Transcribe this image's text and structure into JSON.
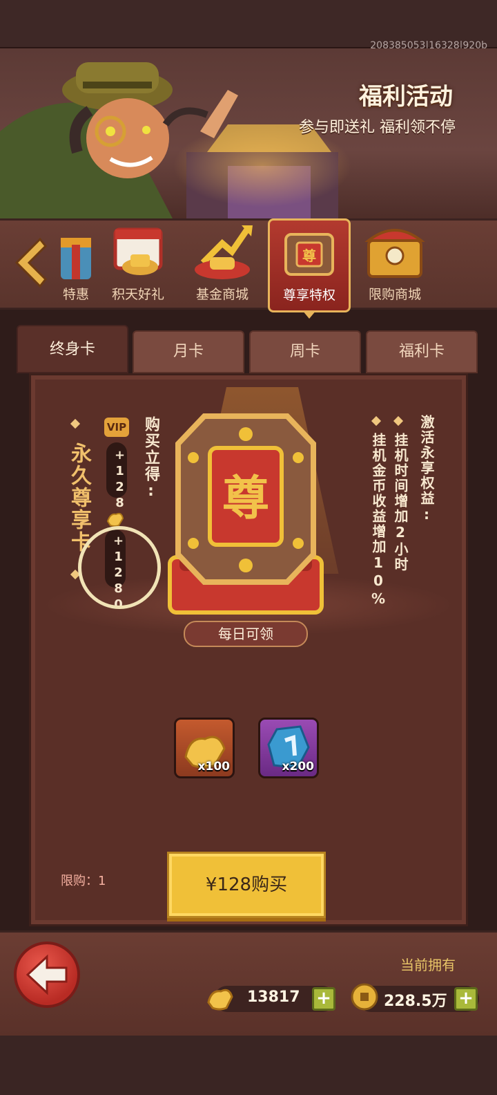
{
  "build_id": "208385053|16328|920b",
  "banner": {
    "title": "福利活动",
    "subtitle": "参与即送礼 福利领不停"
  },
  "categories": [
    {
      "label": "特惠"
    },
    {
      "label": "积天好礼"
    },
    {
      "label": "基金商城"
    },
    {
      "label": "尊享特权"
    },
    {
      "label": "限购商城"
    }
  ],
  "active_category": "尊享特权",
  "subtabs": [
    {
      "label": "终身卡"
    },
    {
      "label": "月卡"
    },
    {
      "label": "周卡"
    },
    {
      "label": "福利卡"
    }
  ],
  "card": {
    "title": "永久尊享卡",
    "buy_now": "购买立得:",
    "vip_label": "VIP",
    "vip_amount": "+128",
    "gold_amount": "+1280",
    "emblem_char": "尊",
    "benefits_title": "激活永享权益:",
    "benefits": [
      "挂机时间增加2小时",
      "挂机金币收益增加10%"
    ],
    "daily_label": "每日可领",
    "daily_rewards": [
      {
        "icon": "gold-ingot-icon",
        "qty": "x100"
      },
      {
        "icon": "blue-rune-gem-icon",
        "qty": "x200"
      }
    ],
    "limit_text": "限购：1",
    "price_button": "¥128购买"
  },
  "footer": {
    "current_own": "当前拥有",
    "gold_ingots": "13817",
    "coins": "228.5万"
  },
  "colors": {
    "accent_gold": "#f0c038",
    "panel_bg": "#5a2f27",
    "active_tab_red": "#b33a2f",
    "back_red": "#e9584c"
  }
}
